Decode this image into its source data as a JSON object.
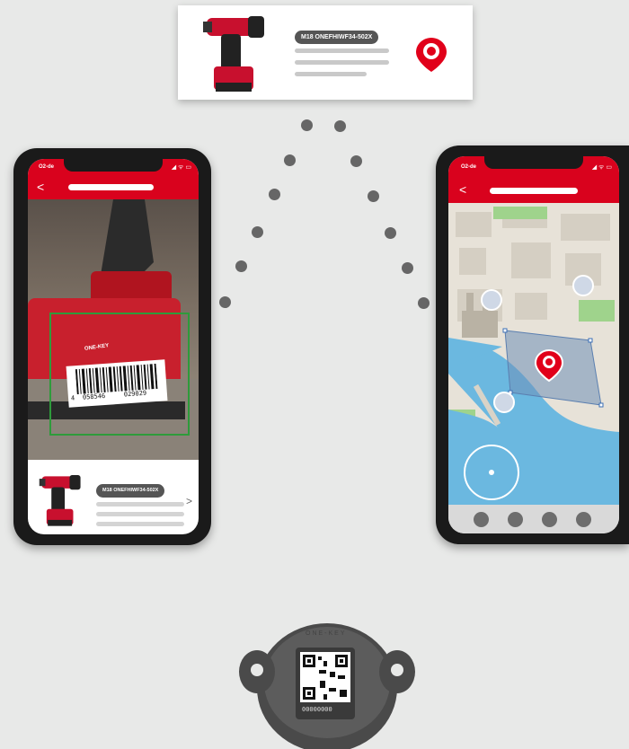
{
  "product": {
    "model_label": "M18 ONEFHIWF34-502X",
    "pin_icon": "location-pin-icon"
  },
  "left_phone": {
    "status_carrier": "O2-de",
    "status_icons": "◢ ᯤ ▭",
    "back_glyph": "<",
    "barcode_left": "4",
    "barcode_mid": "058546",
    "barcode_right": "029029",
    "brand_text": "ONE-KEY",
    "card_model_label": "M18 ONEFHIWF34-502X",
    "card_chevron": ">"
  },
  "right_phone": {
    "status_carrier": "O2-de",
    "status_icons": "◢ ᯤ ▭",
    "back_glyph": "<",
    "nav_dots": 4
  },
  "tracker": {
    "brand": "ONE-KEY",
    "serial": "00000000"
  },
  "colors": {
    "brand_red": "#d9021d",
    "background": "#e8e9e8",
    "scan_frame": "#2e9b3b",
    "map_water": "#6bb8e0"
  }
}
